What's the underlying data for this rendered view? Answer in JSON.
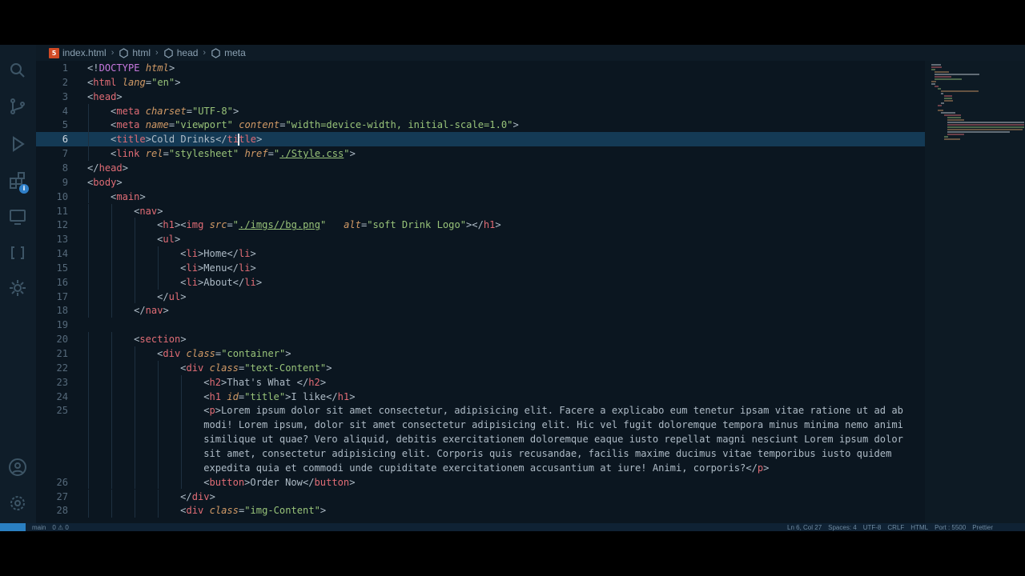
{
  "breadcrumb": {
    "items": [
      {
        "label": "index.html",
        "icon": "html5-icon"
      },
      {
        "label": "html",
        "icon": "element-icon"
      },
      {
        "label": "head",
        "icon": "element-icon"
      },
      {
        "label": "meta",
        "icon": "element-icon"
      }
    ]
  },
  "activity_bar": {
    "items": [
      "search-icon",
      "source-control-icon",
      "run-debug-icon",
      "extensions-icon",
      "remote-explorer-icon",
      "brackets-icon",
      "gear-icon",
      "account-icon",
      "settings-gear-icon"
    ],
    "badge": "i"
  },
  "editor": {
    "current_line": 6,
    "colors": {
      "tag": "#e06c75",
      "attr": "#d19a66",
      "string": "#98c379",
      "doctype": "#c678dd",
      "highlight": "#143a55"
    },
    "lines": [
      {
        "n": 1,
        "indent": 0,
        "tokens": [
          [
            "p",
            "<!"
          ],
          [
            "d",
            "DOCTYPE"
          ],
          [
            "p",
            " "
          ],
          [
            "a",
            "html"
          ],
          [
            "p",
            ">"
          ]
        ]
      },
      {
        "n": 2,
        "indent": 0,
        "tokens": [
          [
            "p",
            "<"
          ],
          [
            "t",
            "html"
          ],
          [
            "p",
            " "
          ],
          [
            "a",
            "lang"
          ],
          [
            "p",
            "="
          ],
          [
            "s",
            "\"en\""
          ],
          [
            "p",
            ">"
          ]
        ]
      },
      {
        "n": 3,
        "indent": 0,
        "tokens": [
          [
            "p",
            "<"
          ],
          [
            "t",
            "head"
          ],
          [
            "p",
            ">"
          ]
        ]
      },
      {
        "n": 4,
        "indent": 1,
        "tokens": [
          [
            "p",
            "<"
          ],
          [
            "t",
            "meta"
          ],
          [
            "p",
            " "
          ],
          [
            "a",
            "charset"
          ],
          [
            "p",
            "="
          ],
          [
            "s",
            "\"UTF-8\""
          ],
          [
            "p",
            ">"
          ]
        ]
      },
      {
        "n": 5,
        "indent": 1,
        "tokens": [
          [
            "p",
            "<"
          ],
          [
            "t",
            "meta"
          ],
          [
            "p",
            " "
          ],
          [
            "a",
            "name"
          ],
          [
            "p",
            "="
          ],
          [
            "s",
            "\"viewport\""
          ],
          [
            "p",
            " "
          ],
          [
            "a",
            "content"
          ],
          [
            "p",
            "="
          ],
          [
            "s",
            "\"width=device-width, initial-scale=1.0\""
          ],
          [
            "p",
            ">"
          ]
        ]
      },
      {
        "n": 6,
        "indent": 1,
        "tokens": [
          [
            "p",
            "<"
          ],
          [
            "t",
            "title"
          ],
          [
            "p",
            ">Cold Drinks</"
          ],
          [
            "t",
            "ti"
          ],
          [
            "cursor",
            ""
          ],
          [
            "t",
            "tle"
          ],
          [
            "p",
            ">"
          ]
        ]
      },
      {
        "n": 7,
        "indent": 1,
        "tokens": [
          [
            "p",
            "<"
          ],
          [
            "t",
            "link"
          ],
          [
            "p",
            " "
          ],
          [
            "a",
            "rel"
          ],
          [
            "p",
            "="
          ],
          [
            "s",
            "\"stylesheet\""
          ],
          [
            "p",
            " "
          ],
          [
            "a",
            "href"
          ],
          [
            "p",
            "="
          ],
          [
            "s",
            "\""
          ],
          [
            "u",
            "./Style.css"
          ],
          [
            "s",
            "\""
          ],
          [
            "p",
            ">"
          ]
        ]
      },
      {
        "n": 8,
        "indent": 0,
        "tokens": [
          [
            "p",
            "</"
          ],
          [
            "t",
            "head"
          ],
          [
            "p",
            ">"
          ]
        ]
      },
      {
        "n": 9,
        "indent": 0,
        "tokens": [
          [
            "p",
            "<"
          ],
          [
            "t",
            "body"
          ],
          [
            "p",
            ">"
          ]
        ]
      },
      {
        "n": 10,
        "indent": 1,
        "tokens": [
          [
            "p",
            "<"
          ],
          [
            "t",
            "main"
          ],
          [
            "p",
            ">"
          ]
        ]
      },
      {
        "n": 11,
        "indent": 2,
        "tokens": [
          [
            "p",
            "<"
          ],
          [
            "t",
            "nav"
          ],
          [
            "p",
            ">"
          ]
        ]
      },
      {
        "n": 12,
        "indent": 3,
        "tokens": [
          [
            "p",
            "<"
          ],
          [
            "t",
            "h1"
          ],
          [
            "p",
            "><"
          ],
          [
            "t",
            "img"
          ],
          [
            "p",
            " "
          ],
          [
            "a",
            "src"
          ],
          [
            "p",
            "="
          ],
          [
            "s",
            "\""
          ],
          [
            "u",
            "./imgs//bg.png"
          ],
          [
            "s",
            "\""
          ],
          [
            "p",
            "   "
          ],
          [
            "a",
            "alt"
          ],
          [
            "p",
            "="
          ],
          [
            "s",
            "\"soft Drink Logo\""
          ],
          [
            "p",
            "></"
          ],
          [
            "t",
            "h1"
          ],
          [
            "p",
            ">"
          ]
        ]
      },
      {
        "n": 13,
        "indent": 3,
        "tokens": [
          [
            "p",
            "<"
          ],
          [
            "t",
            "ul"
          ],
          [
            "p",
            ">"
          ]
        ]
      },
      {
        "n": 14,
        "indent": 4,
        "tokens": [
          [
            "p",
            "<"
          ],
          [
            "t",
            "li"
          ],
          [
            "p",
            ">Home</"
          ],
          [
            "t",
            "li"
          ],
          [
            "p",
            ">"
          ]
        ]
      },
      {
        "n": 15,
        "indent": 4,
        "tokens": [
          [
            "p",
            "<"
          ],
          [
            "t",
            "li"
          ],
          [
            "p",
            ">Menu</"
          ],
          [
            "t",
            "li"
          ],
          [
            "p",
            ">"
          ]
        ]
      },
      {
        "n": 16,
        "indent": 4,
        "tokens": [
          [
            "p",
            "<"
          ],
          [
            "t",
            "li"
          ],
          [
            "p",
            ">About</"
          ],
          [
            "t",
            "li"
          ],
          [
            "p",
            ">"
          ]
        ]
      },
      {
        "n": 17,
        "indent": 3,
        "tokens": [
          [
            "p",
            "</"
          ],
          [
            "t",
            "ul"
          ],
          [
            "p",
            ">"
          ]
        ]
      },
      {
        "n": 18,
        "indent": 2,
        "tokens": [
          [
            "p",
            "</"
          ],
          [
            "t",
            "nav"
          ],
          [
            "p",
            ">"
          ]
        ]
      },
      {
        "n": 19,
        "indent": 0,
        "tokens": []
      },
      {
        "n": 20,
        "indent": 2,
        "tokens": [
          [
            "p",
            "<"
          ],
          [
            "t",
            "section"
          ],
          [
            "p",
            ">"
          ]
        ]
      },
      {
        "n": 21,
        "indent": 3,
        "tokens": [
          [
            "p",
            "<"
          ],
          [
            "t",
            "div"
          ],
          [
            "p",
            " "
          ],
          [
            "a",
            "class"
          ],
          [
            "p",
            "="
          ],
          [
            "s",
            "\"container\""
          ],
          [
            "p",
            ">"
          ]
        ]
      },
      {
        "n": 22,
        "indent": 4,
        "tokens": [
          [
            "p",
            "<"
          ],
          [
            "t",
            "div"
          ],
          [
            "p",
            " "
          ],
          [
            "a",
            "class"
          ],
          [
            "p",
            "="
          ],
          [
            "s",
            "\"text-Content\""
          ],
          [
            "p",
            ">"
          ]
        ]
      },
      {
        "n": 23,
        "indent": 5,
        "tokens": [
          [
            "p",
            "<"
          ],
          [
            "t",
            "h2"
          ],
          [
            "p",
            ">That's What </"
          ],
          [
            "t",
            "h2"
          ],
          [
            "p",
            ">"
          ]
        ]
      },
      {
        "n": 24,
        "indent": 5,
        "tokens": [
          [
            "p",
            "<"
          ],
          [
            "t",
            "h1"
          ],
          [
            "p",
            " "
          ],
          [
            "a",
            "id"
          ],
          [
            "p",
            "="
          ],
          [
            "s",
            "\"title\""
          ],
          [
            "p",
            ">I like</"
          ],
          [
            "t",
            "h1"
          ],
          [
            "p",
            ">"
          ]
        ]
      },
      {
        "n": 25,
        "indent": 5,
        "tokens": [
          [
            "p",
            "<"
          ],
          [
            "t",
            "p"
          ],
          [
            "p",
            ">Lorem ipsum dolor sit amet consectetur, adipisicing elit. Facere a explicabo eum tenetur ipsam vitae ratione ut ad ab"
          ]
        ]
      },
      {
        "n": null,
        "indent": 5,
        "tokens": [
          [
            "p",
            "modi! Lorem ipsum, dolor sit amet consectetur adipisicing elit. Hic vel fugit doloremque tempora minus minima nemo animi"
          ]
        ]
      },
      {
        "n": null,
        "indent": 5,
        "tokens": [
          [
            "p",
            "similique ut quae? Vero aliquid, debitis exercitationem doloremque eaque iusto repellat magni nesciunt Lorem ipsum dolor"
          ]
        ]
      },
      {
        "n": null,
        "indent": 5,
        "tokens": [
          [
            "p",
            "sit amet, consectetur adipisicing elit. Corporis quis recusandae, facilis maxime ducimus vitae temporibus iusto quidem"
          ]
        ]
      },
      {
        "n": null,
        "indent": 5,
        "tokens": [
          [
            "p",
            "expedita quia et commodi unde cupiditate exercitationem accusantium at iure! Animi, corporis?</"
          ],
          [
            "t",
            "p"
          ],
          [
            "p",
            ">"
          ]
        ]
      },
      {
        "n": 26,
        "indent": 5,
        "tokens": [
          [
            "p",
            "<"
          ],
          [
            "t",
            "button"
          ],
          [
            "p",
            ">Order Now</"
          ],
          [
            "t",
            "button"
          ],
          [
            "p",
            ">"
          ]
        ]
      },
      {
        "n": 27,
        "indent": 4,
        "tokens": [
          [
            "p",
            "</"
          ],
          [
            "t",
            "div"
          ],
          [
            "p",
            ">"
          ]
        ]
      },
      {
        "n": 28,
        "indent": 4,
        "tokens": [
          [
            "p",
            "<"
          ],
          [
            "t",
            "div"
          ],
          [
            "p",
            " "
          ],
          [
            "a",
            "class"
          ],
          [
            "p",
            "="
          ],
          [
            "s",
            "\"img-Content\""
          ],
          [
            "p",
            ">"
          ]
        ]
      }
    ]
  },
  "status_bar": {
    "left": [
      "main",
      "0 ⚠ 0"
    ],
    "right": [
      "Ln 6, Col 27",
      "Spaces: 4",
      "UTF-8",
      "CRLF",
      "HTML",
      "Port : 5500",
      "Prettier"
    ]
  }
}
